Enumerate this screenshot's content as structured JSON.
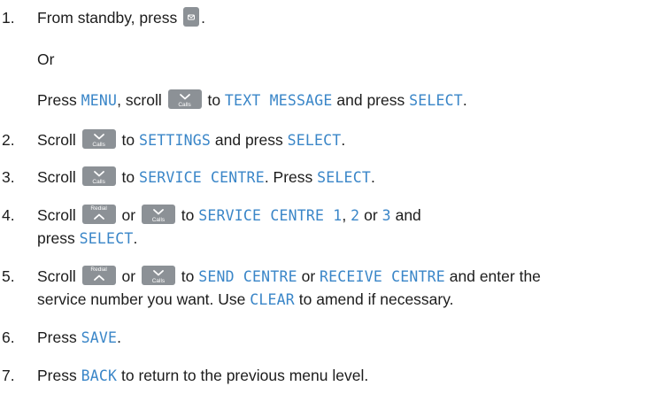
{
  "steps": {
    "s1": {
      "num": "1.",
      "a": "From standby, press ",
      "b": "."
    },
    "or": "Or",
    "s1b": {
      "a": "Press ",
      "menu": "MENU",
      "b": ", scroll ",
      "c": " to ",
      "text_message": "TEXT MESSAGE",
      "d": " and press ",
      "select": "SELECT",
      "e": "."
    },
    "s2": {
      "num": "2.",
      "a": "Scroll ",
      "b": " to ",
      "settings": "SETTINGS",
      "c": " and press ",
      "select": "SELECT",
      "d": "."
    },
    "s3": {
      "num": "3.",
      "a": "Scroll ",
      "b": " to ",
      "service_centre": "SERVICE CENTRE",
      "c": ". Press ",
      "select": "SELECT",
      "d": "."
    },
    "s4": {
      "num": "4.",
      "a": "Scroll ",
      "b": " or ",
      "c": " to ",
      "sc1": "SERVICE CENTRE 1",
      "d": ", ",
      "two": "2",
      "e": " or ",
      "three": "3",
      "f": " and",
      "line2a": "press ",
      "select": "SELECT",
      "line2b": "."
    },
    "s5": {
      "num": "5.",
      "a": "Scroll ",
      "b": " or ",
      "c": " to ",
      "send": "SEND CENTRE",
      "d": " or ",
      "receive": "RECEIVE CENTRE",
      "e": " and enter the",
      "line2a": "service number you want. Use ",
      "clear": "CLEAR",
      "line2b": " to amend if necessary."
    },
    "s6": {
      "num": "6.",
      "a": "Press ",
      "save": "SAVE",
      "b": "."
    },
    "s7": {
      "num": "7.",
      "a": "Press ",
      "back": "BACK",
      "b": " to return to the previous menu level."
    }
  },
  "keys": {
    "calls_label": "Calls",
    "redial_label": "Redial",
    "message_icon": "envelope-icon",
    "down_icon": "chevron-down-icon",
    "up_icon": "chevron-up-icon"
  },
  "colors": {
    "display_text": "#3a86c8",
    "key_bg": "#8c9196",
    "body_text": "#1c1c1c"
  }
}
